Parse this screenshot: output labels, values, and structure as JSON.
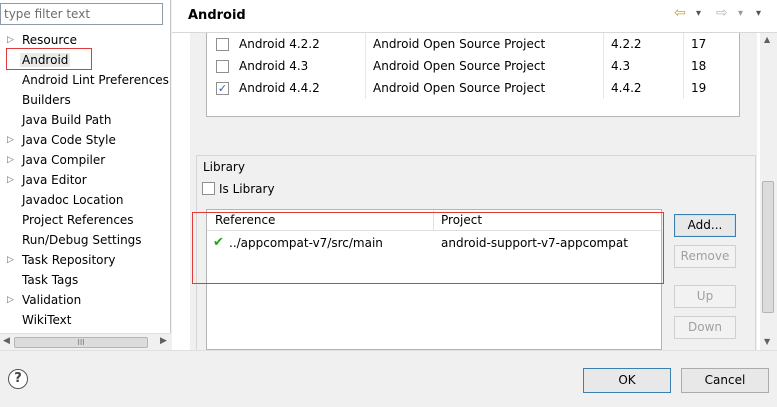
{
  "filter": {
    "placeholder": "type filter text"
  },
  "tree": [
    {
      "label": "Resource",
      "arrow": "▷"
    },
    {
      "label": "Android",
      "arrow": ""
    },
    {
      "label": "Android Lint Preferences",
      "arrow": ""
    },
    {
      "label": "Builders",
      "arrow": ""
    },
    {
      "label": "Java Build Path",
      "arrow": ""
    },
    {
      "label": "Java Code Style",
      "arrow": "▷"
    },
    {
      "label": "Java Compiler",
      "arrow": "▷"
    },
    {
      "label": "Java Editor",
      "arrow": "▷"
    },
    {
      "label": "Javadoc Location",
      "arrow": ""
    },
    {
      "label": "Project References",
      "arrow": ""
    },
    {
      "label": "Run/Debug Settings",
      "arrow": ""
    },
    {
      "label": "Task Repository",
      "arrow": "▷"
    },
    {
      "label": "Task Tags",
      "arrow": ""
    },
    {
      "label": "Validation",
      "arrow": "▷"
    },
    {
      "label": "WikiText",
      "arrow": ""
    }
  ],
  "left_scroll": {
    "left_arrow": "◀",
    "right_arrow": "▶",
    "grip": "III"
  },
  "page": {
    "title": "Android",
    "nav": {
      "back": "⇦",
      "back_menu": "▾",
      "forward": "⇨",
      "forward_menu": "▾",
      "view_menu": "▾"
    }
  },
  "targets": [
    {
      "name": "Android 4.2.2",
      "vendor": "Android Open Source Project",
      "platform": "4.2.2",
      "api": "17",
      "checked": ""
    },
    {
      "name": "Android 4.3",
      "vendor": "Android Open Source Project",
      "platform": "4.3",
      "api": "18",
      "checked": ""
    },
    {
      "name": "Android 4.4.2",
      "vendor": "Android Open Source Project",
      "platform": "4.4.2",
      "api": "19",
      "checked": "✓"
    }
  ],
  "library": {
    "title": "Library",
    "is_library_label": "Is Library",
    "columns": {
      "reference": "Reference",
      "project": "Project"
    },
    "rows": [
      {
        "status": "✔",
        "reference": "../appcompat-v7/src/main",
        "project": "android-support-v7-appcompat"
      }
    ],
    "buttons": {
      "add": "Add...",
      "remove": "Remove",
      "up": "Up",
      "down": "Down"
    }
  },
  "right_scroll": {
    "up_arrow": "▲",
    "down_arrow": "▼"
  },
  "dialog": {
    "help": "?",
    "ok": "OK",
    "cancel": "Cancel"
  },
  "colors": {
    "highlight": "#e03a3a",
    "check": "#1ea51e"
  }
}
